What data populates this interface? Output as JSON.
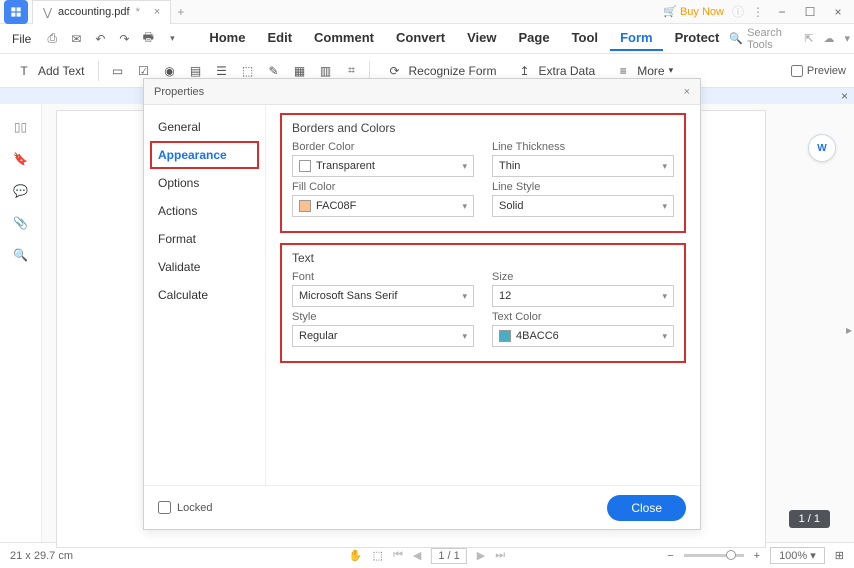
{
  "title": {
    "filename": "accounting.pdf",
    "dirty": "*"
  },
  "buynow": "Buy Now",
  "menus": {
    "file": "File",
    "home": "Home",
    "edit": "Edit",
    "comment": "Comment",
    "convert": "Convert",
    "view": "View",
    "page": "Page",
    "tool": "Tool",
    "form": "Form",
    "protect": "Protect"
  },
  "search_placeholder": "Search Tools",
  "toolbar": {
    "add_text": "Add Text",
    "recognize": "Recognize Form",
    "extra_data": "Extra Data",
    "more": "More",
    "preview": "Preview"
  },
  "properties": {
    "title": "Properties",
    "nav": {
      "general": "General",
      "appearance": "Appearance",
      "options": "Options",
      "actions": "Actions",
      "format": "Format",
      "validate": "Validate",
      "calculate": "Calculate"
    },
    "borders_colors": {
      "title": "Borders and Colors",
      "border_color": {
        "label": "Border Color",
        "value": "Transparent"
      },
      "line_thickness": {
        "label": "Line Thickness",
        "value": "Thin"
      },
      "fill_color": {
        "label": "Fill Color",
        "value": "FAC08F",
        "swatch": "#FAC08F"
      },
      "line_style": {
        "label": "Line Style",
        "value": "Solid"
      }
    },
    "text": {
      "title": "Text",
      "font": {
        "label": "Font",
        "value": "Microsoft Sans Serif"
      },
      "size": {
        "label": "Size",
        "value": "12"
      },
      "style": {
        "label": "Style",
        "value": "Regular"
      },
      "text_color": {
        "label": "Text Color",
        "value": "4BACC6",
        "swatch": "#4BACC6"
      }
    },
    "locked": "Locked",
    "close": "Close"
  },
  "status": {
    "dimensions": "21 x 29.7 cm",
    "page": "1",
    "pages": "/ 1",
    "zoom": "100%",
    "page_badge": "1 / 1"
  }
}
